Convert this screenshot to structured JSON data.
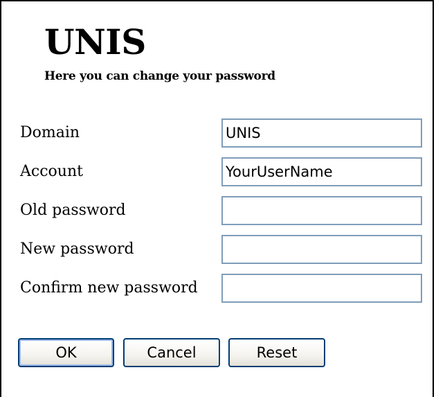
{
  "header": {
    "title": "UNIS",
    "subtitle": "Here you can change your password"
  },
  "form": {
    "domain": {
      "label": "Domain",
      "value": "UNIS"
    },
    "account": {
      "label": "Account",
      "value": "YourUserName"
    },
    "old_password": {
      "label": "Old password",
      "value": ""
    },
    "new_password": {
      "label": "New password",
      "value": ""
    },
    "confirm_password": {
      "label": "Confirm new password",
      "value": ""
    }
  },
  "buttons": {
    "ok": "OK",
    "cancel": "Cancel",
    "reset": "Reset"
  },
  "colors": {
    "input_border": "#7f9db9",
    "button_border": "#003c74",
    "default_button_focus": "#9eb8e8"
  }
}
